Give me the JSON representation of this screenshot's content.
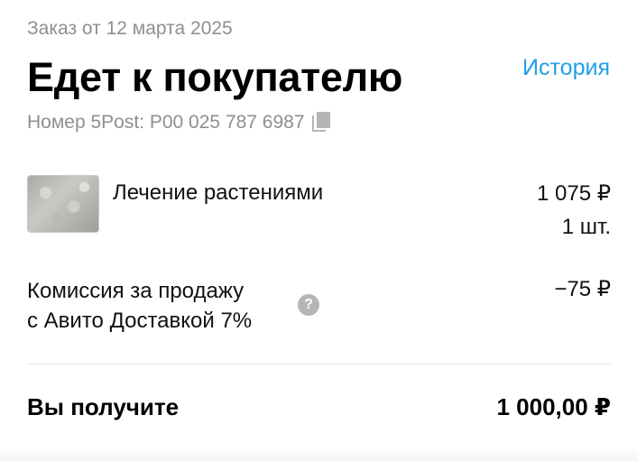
{
  "header": {
    "order_date": "Заказ от 12 марта 2025",
    "status": "Едет к покупателю",
    "history_link": "История",
    "tracking": "Номер 5Post: P00 025 787 6987",
    "copy_icon": "copy-icon"
  },
  "item": {
    "name": "Лечение растениями",
    "price": "1 075 ₽",
    "quantity": "1 шт."
  },
  "fee": {
    "label_line1": "Комиссия за продажу",
    "label_line2": "с Авито Доставкой 7%",
    "amount": "−75 ₽",
    "help_icon": "?"
  },
  "total": {
    "label": "Вы получите",
    "amount": "1 000,00 ₽"
  },
  "colors": {
    "link": "#1fa0e8",
    "secondary_text": "#8f8f8f"
  }
}
